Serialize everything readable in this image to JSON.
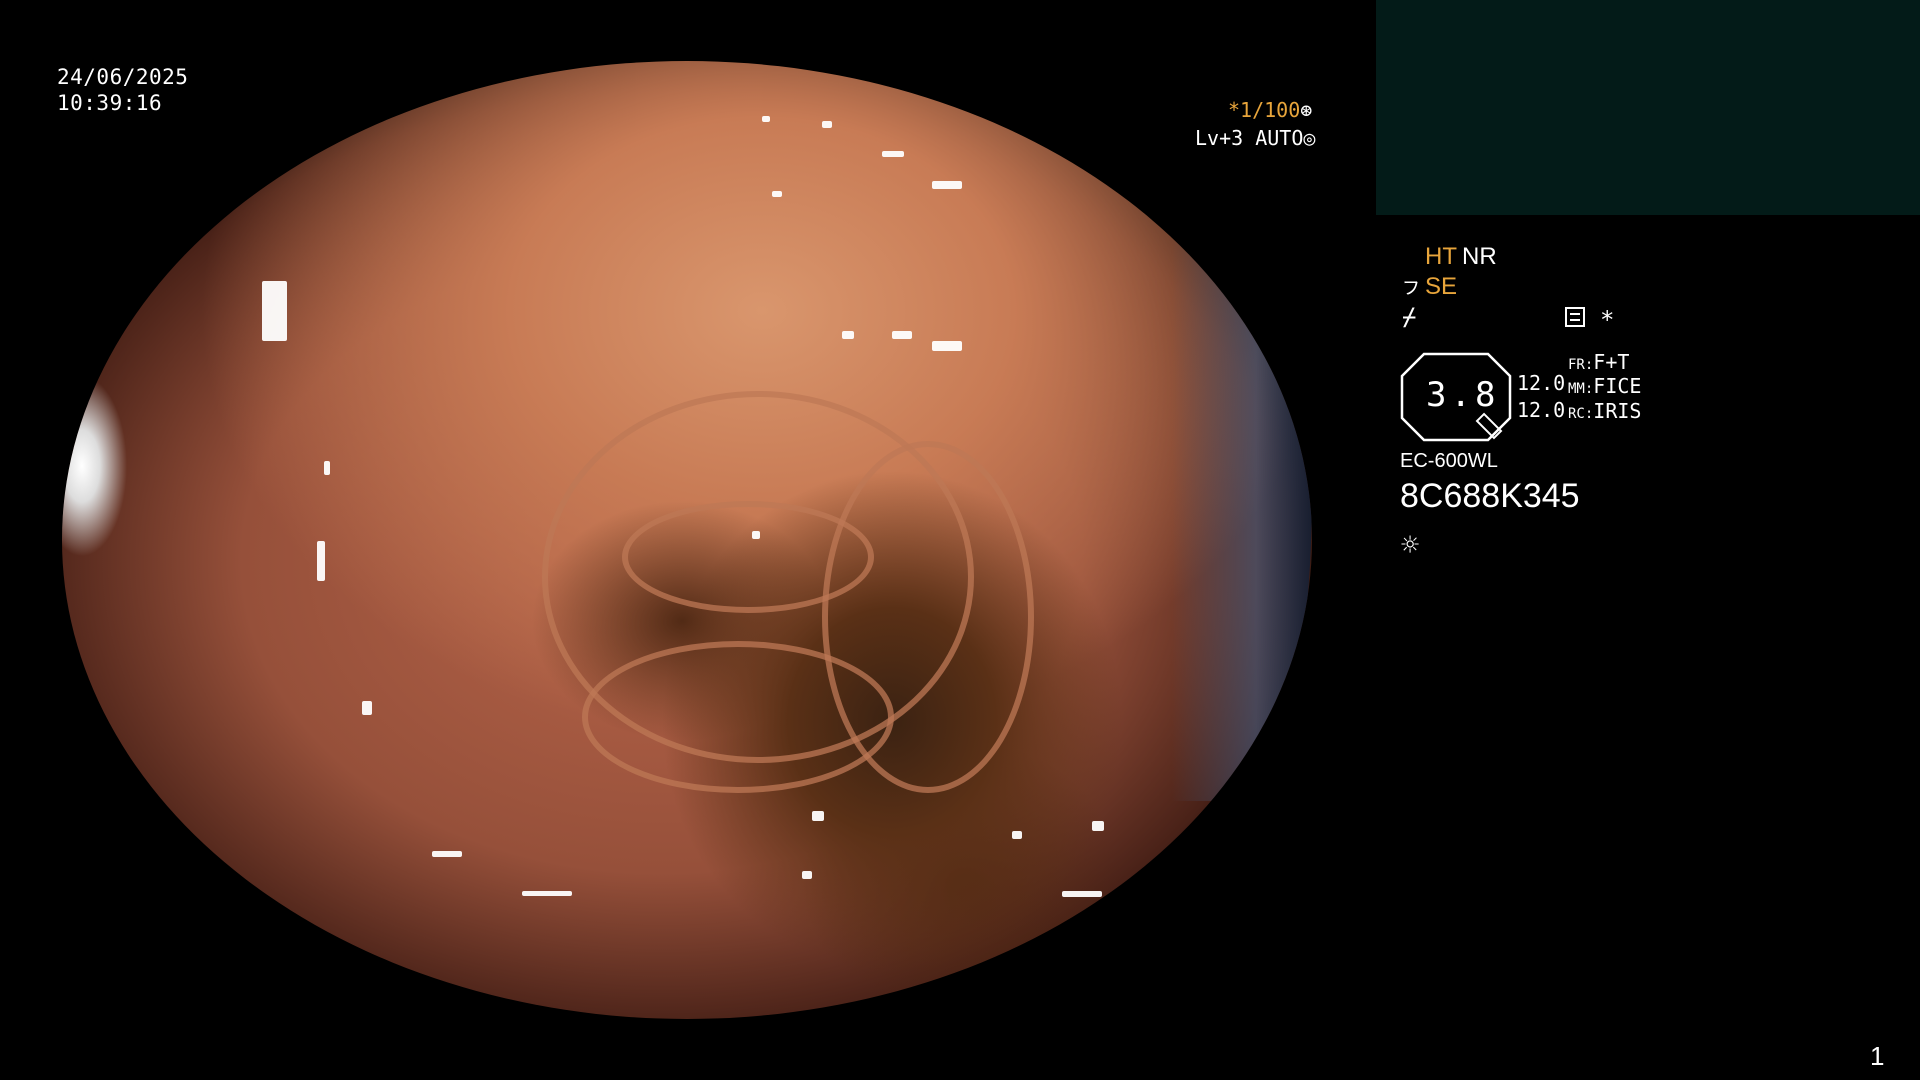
{
  "datetime": {
    "date": "24/06/2025",
    "time": "10:39:16"
  },
  "shutter": {
    "value": "*1/100",
    "icon": "shutter-icon"
  },
  "exposure": {
    "value": "Lv+3 AUTO",
    "icon": "iris-icon"
  },
  "settings": {
    "ht": "HT",
    "nr": "NR",
    "se": "SE",
    "se_icon": "structure-icon",
    "freeze_icon": "freeze-icon",
    "memo_icon": "memo-icon",
    "star": "*"
  },
  "zoom": {
    "value": "3.8",
    "line1": "12.0",
    "line2": "12.0"
  },
  "modes": {
    "fr_label": "FR:",
    "fr_value": "F+T",
    "mm_label": "MM:",
    "mm_value": "FICE",
    "rc_label": "RC:",
    "rc_value": "IRIS"
  },
  "scope": {
    "model": "EC-600WL",
    "serial": "8C688K345",
    "light_icon": "light-icon"
  },
  "page_number": "1",
  "colors": {
    "accent": "#e8a53b",
    "panel": "#031b18",
    "background": "#000000"
  }
}
